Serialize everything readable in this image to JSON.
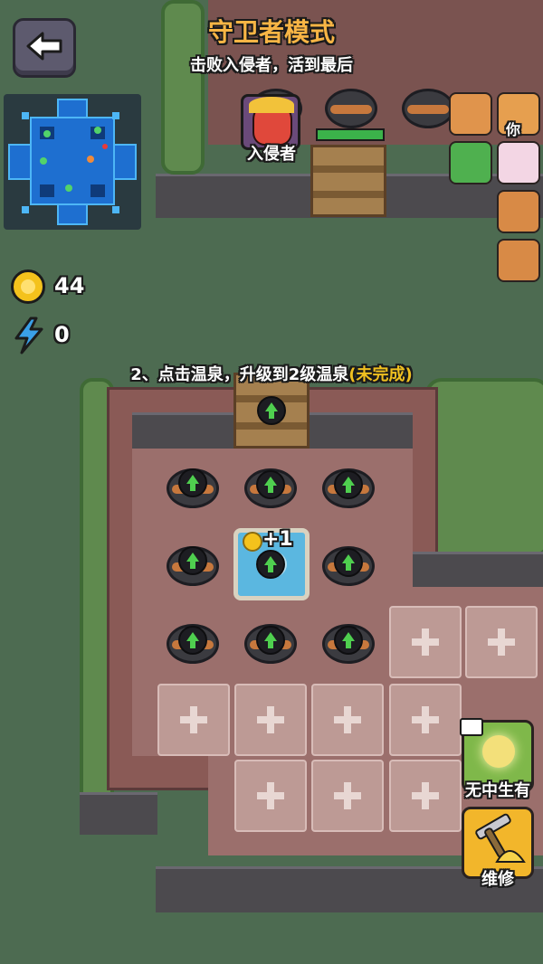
{
  "header": {
    "title": "守卫者模式",
    "subtitle": "击败入侵者，活到最后",
    "back_icon": "back-arrow-icon"
  },
  "invader": {
    "label": "入侵者"
  },
  "players": {
    "you_label": "你"
  },
  "resources": {
    "coins": "44",
    "energy": "0",
    "coin_color": "#f4c21c",
    "energy_color": "#3aa0e8"
  },
  "task": {
    "text": "2、点击温泉，升级到2级温泉",
    "status": "(未完成)",
    "status_color": "#f0c020"
  },
  "hot_spring": {
    "bonus": "+1"
  },
  "side_buttons": {
    "create": "无中生有",
    "repair": "维修"
  }
}
